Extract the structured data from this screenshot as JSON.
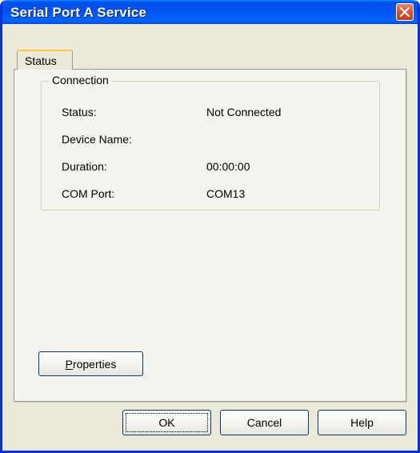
{
  "window": {
    "title": "Serial Port A Service",
    "close_icon": "close-icon"
  },
  "tabs": [
    {
      "label": "Status",
      "selected": true
    }
  ],
  "connection": {
    "legend": "Connection",
    "rows": [
      {
        "label": "Status:",
        "value": "Not Connected"
      },
      {
        "label": "Device Name:",
        "value": ""
      },
      {
        "label": "Duration:",
        "value": "00:00:00"
      },
      {
        "label": "COM Port:",
        "value": "COM13"
      }
    ]
  },
  "properties_button": {
    "accel": "P",
    "rest": "roperties"
  },
  "footer": {
    "ok_label": "OK",
    "cancel_label": "Cancel",
    "help_label": "Help"
  },
  "colors": {
    "titlebar": "#0053ee",
    "window_bg": "#ece9d8",
    "panel_bg": "#f4f3ee",
    "tab_highlight": "#ffc83c",
    "close_button": "#d9532c"
  }
}
